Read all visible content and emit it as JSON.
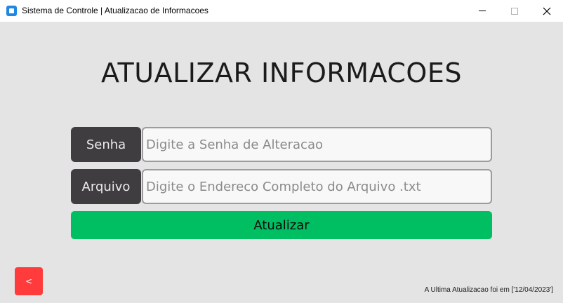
{
  "window": {
    "title": "Sistema de Controle | Atualizacao de Informacoes",
    "app_icon": "app-icon",
    "controls": {
      "minimize_icon": "minimize-icon",
      "maximize_icon": "maximize-icon",
      "close_icon": "close-icon",
      "close_glyph": "✕"
    }
  },
  "main": {
    "title": "ATUALIZAR INFORMACOES",
    "password": {
      "label": "Senha",
      "placeholder": "Digite a Senha de Alteracao",
      "value": ""
    },
    "file": {
      "label": "Arquivo",
      "placeholder": "Digite o Endereco Completo do Arquivo .txt",
      "value": ""
    },
    "update_button": "Atualizar",
    "back_button": "<",
    "status": "A Ultima Atualizacao foi em ['12/04/2023']"
  },
  "colors": {
    "background": "#e4e4e4",
    "label_bg": "#3f3d3f",
    "update_button": "#00bf63",
    "back_button": "#ff3b3b"
  }
}
